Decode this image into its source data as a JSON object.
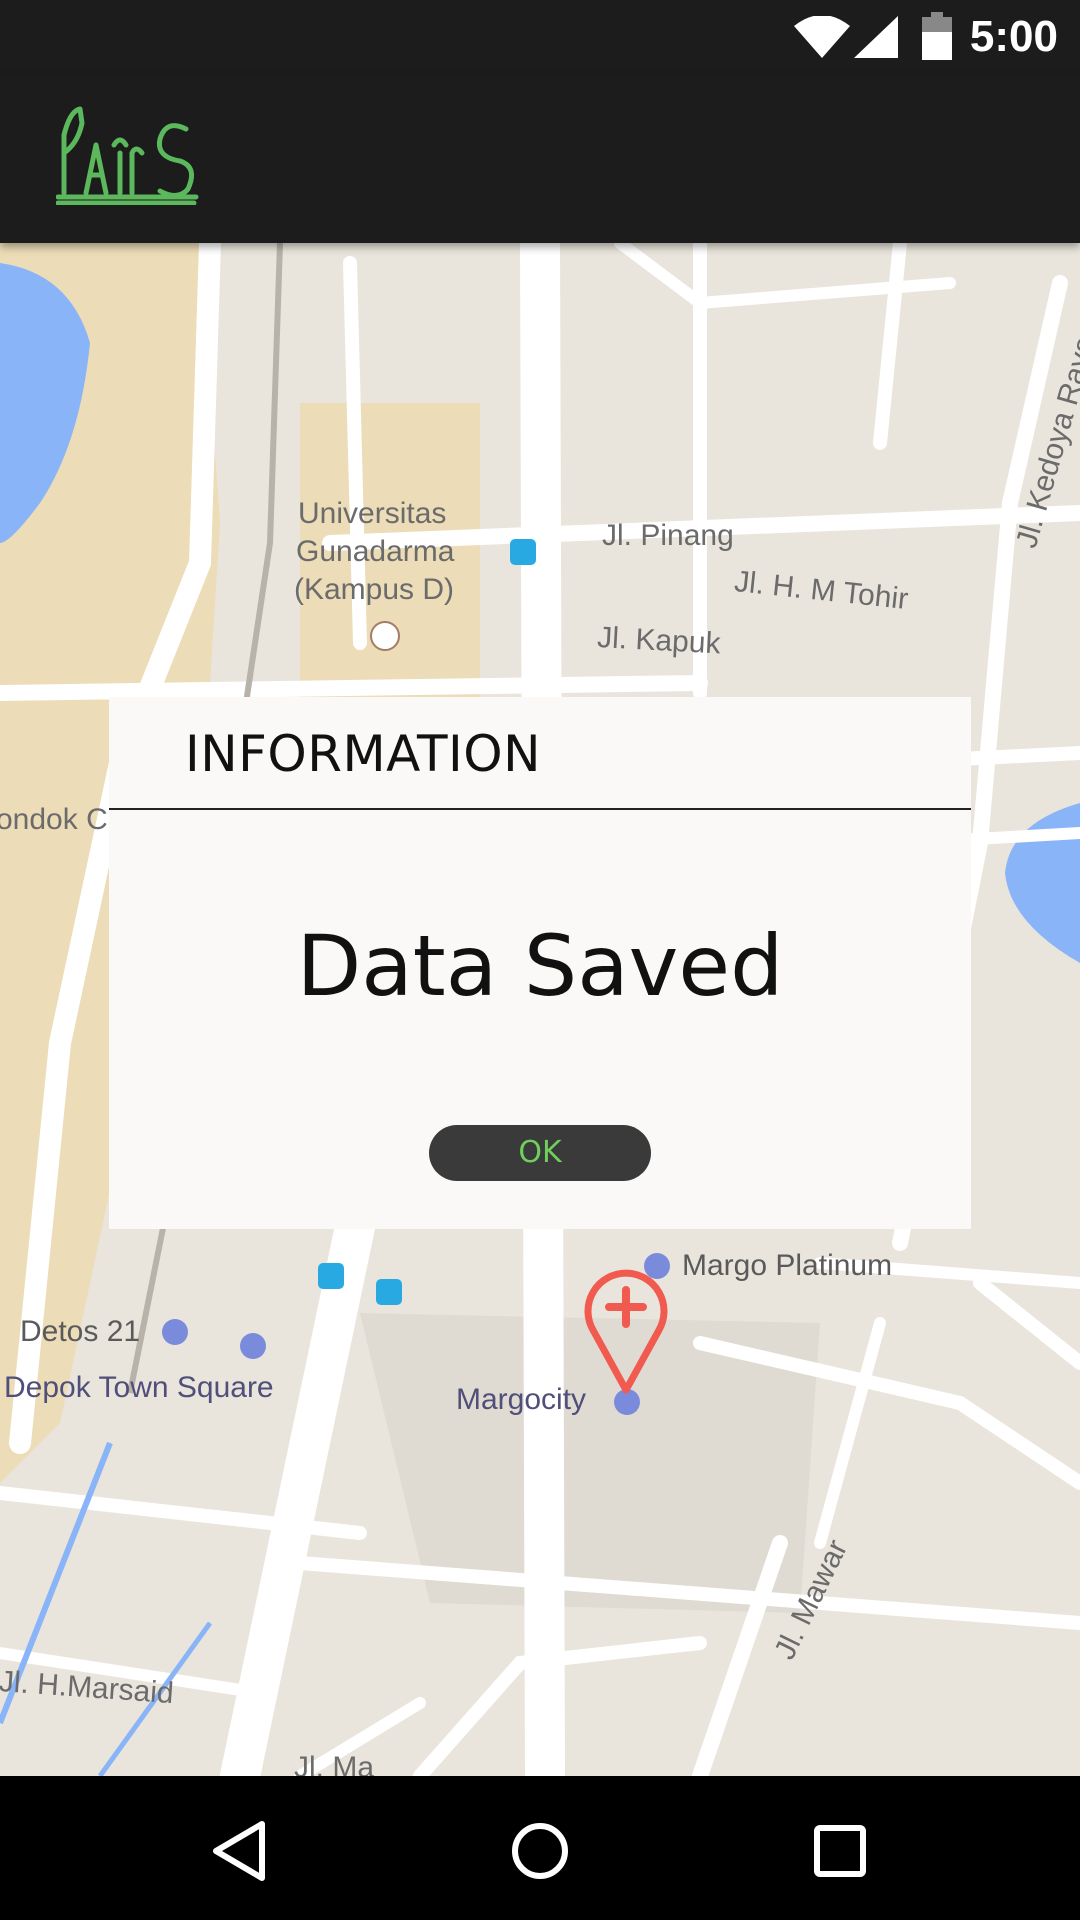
{
  "status_bar": {
    "time": "5:00",
    "icons": [
      "wifi-icon",
      "cell-signal-icon",
      "battery-icon"
    ]
  },
  "app_bar": {
    "logo_text": "PAIS",
    "logo_color": "#5cb85c"
  },
  "map": {
    "labels": {
      "universitas": "Universitas",
      "gunadarma": "Gunadarma",
      "kampus": "(Kampus D)",
      "jl_pinang": "Jl. Pinang",
      "jl_hm_tohir": "Jl. H. M Tohir",
      "jl_kapuk": "Jl. Kapuk",
      "jl_kedoya": "Jl. Kedoya Raya",
      "pondok": "ondok C",
      "margo_platinum": "Margo Platinum",
      "detos": "Detos 21",
      "depok_town_square": "Depok Town Square",
      "margocity": "Margocity",
      "jl_mawar": "Jl. Mawar",
      "jl_hmarsaid": "Jl. H.Marsaid",
      "jl_ma": "Jl. Ma"
    },
    "marker_color": "#f05a4f"
  },
  "dialog": {
    "title": "INFORMATION",
    "message": "Data Saved",
    "ok_label": "OK",
    "ok_color": "#6fcf5a"
  },
  "nav_bar": {
    "buttons": [
      "back-icon",
      "home-icon",
      "recents-icon"
    ]
  }
}
